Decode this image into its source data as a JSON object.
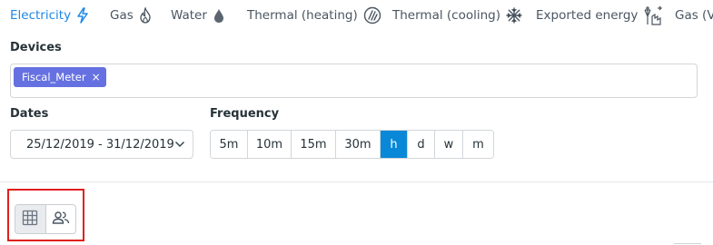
{
  "tabs": [
    {
      "label": "Electricity",
      "icon": "bolt-icon",
      "active": true
    },
    {
      "label": "Gas",
      "icon": "flame-icon",
      "active": false
    },
    {
      "label": "Water",
      "icon": "water-drop-icon",
      "active": false
    },
    {
      "label": "Thermal (heating)",
      "icon": "heating-icon",
      "active": false
    },
    {
      "label": "Thermal (cooling)",
      "icon": "snowflake-icon",
      "active": false
    },
    {
      "label": "Exported energy",
      "icon": "exported-energy-icon",
      "active": false
    },
    {
      "label": "Gas (Vo",
      "icon": "",
      "active": false
    }
  ],
  "devices": {
    "label": "Devices",
    "selected": [
      "Fiscal_Meter"
    ],
    "remove_glyph": "×"
  },
  "dates": {
    "label": "Dates",
    "value": "25/12/2019 - 31/12/2019"
  },
  "frequency": {
    "label": "Frequency",
    "options": [
      "5m",
      "10m",
      "15m",
      "30m",
      "h",
      "d",
      "w",
      "m"
    ],
    "selected": "h"
  },
  "view_toggle": {
    "options": [
      {
        "icon": "grid-table-icon",
        "active": true
      },
      {
        "icon": "users-icon",
        "active": false
      }
    ]
  },
  "colors": {
    "accent": "#1e88e5",
    "chip": "#6671e1",
    "active_freq": "#0a88d8",
    "highlight": "#e0201b"
  }
}
